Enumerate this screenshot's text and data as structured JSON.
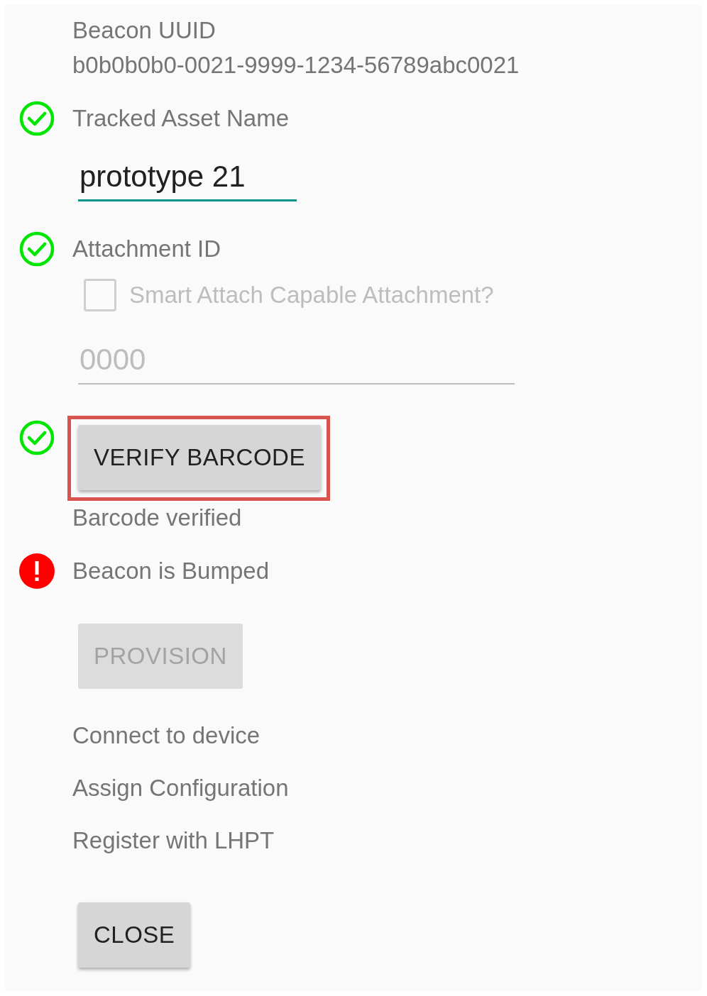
{
  "uuid": {
    "label": "Beacon UUID",
    "value": "b0b0b0b0-0021-9999-1234-56789abc0021"
  },
  "asset": {
    "ok": true,
    "label": "Tracked Asset Name",
    "value": "prototype 21"
  },
  "attachment": {
    "ok": true,
    "label": "Attachment ID",
    "checkbox": {
      "label": "Smart Attach Capable Attachment?",
      "checked": false,
      "disabled": true
    },
    "field": {
      "placeholder": "0000"
    }
  },
  "barcode": {
    "ok": true,
    "button": {
      "label": "VERIFY BARCODE",
      "highlighted": true
    },
    "message": "Barcode verified"
  },
  "bump": {
    "ok": false,
    "label": "Beacon is Bumped"
  },
  "provision_button": {
    "label": "PROVISION",
    "disabled": true
  },
  "progress_steps": [
    "Connect to device",
    "Assign Configuration",
    "Register with LHPT"
  ],
  "close_button": {
    "label": "CLOSE",
    "disabled": false
  }
}
